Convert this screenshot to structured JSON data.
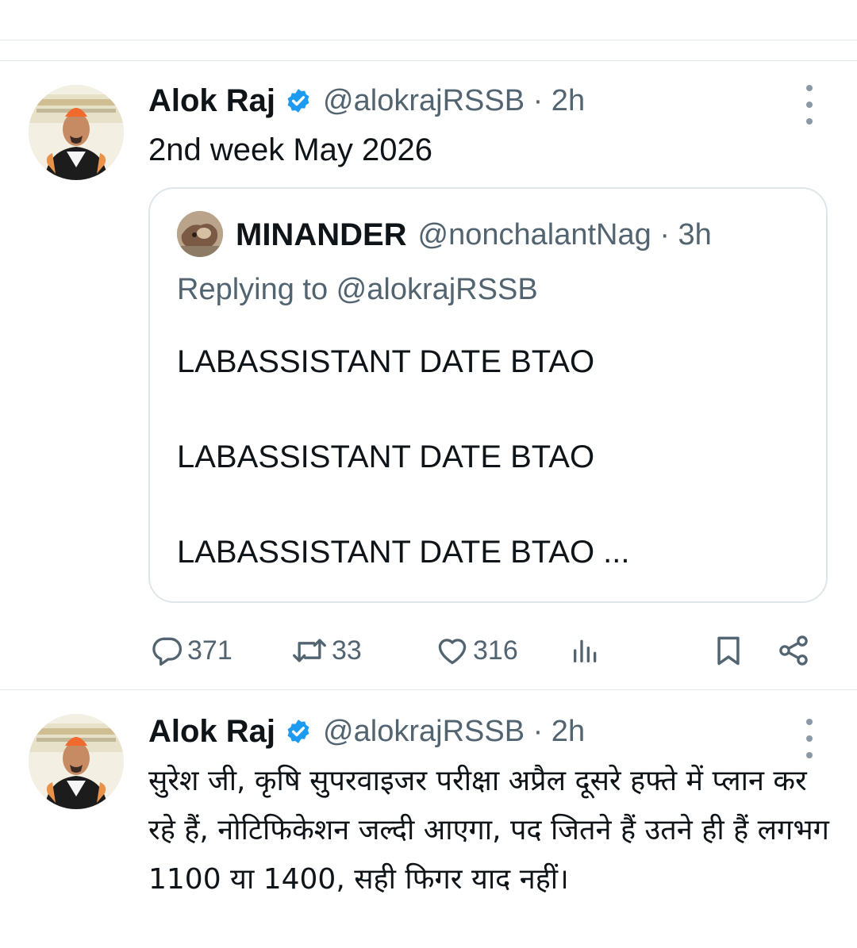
{
  "tweets": [
    {
      "author": "Alok Raj",
      "handle_time": "@alokrajRSSB · 2h",
      "text": "2nd week May 2026",
      "quoted": {
        "author": "MINANDER",
        "handle_time": "@nonchalantNag · 3h",
        "replying": "Replying to @alokrajRSSB",
        "lines": [
          "LABASSISTANT DATE BTAO",
          "LABASSISTANT DATE BTAO",
          "LABASSISTANT DATE BTAO ..."
        ]
      },
      "stats": {
        "replies": "371",
        "reposts": "33",
        "likes": "316"
      }
    },
    {
      "author": "Alok Raj",
      "handle_time": "@alokrajRSSB · 2h",
      "text": "सुरेश जी, कृषि सुपरवाइजर परीक्षा अप्रैल दूसरे हफ्ते में प्लान कर रहे हैं, नोटिफिकेशन जल्दी आएगा, पद जितने हैं उतने ही हैं  लगभग 1100 या 1400, सही फिगर याद नहीं।"
    }
  ],
  "colors": {
    "verified": "#1d9bf0",
    "secondary_text": "#536471",
    "border": "#dfe6ea"
  },
  "icons": [
    "verified-badge-icon",
    "more-icon",
    "reply-icon",
    "repost-icon",
    "like-icon",
    "views-icon",
    "bookmark-icon",
    "share-icon"
  ]
}
